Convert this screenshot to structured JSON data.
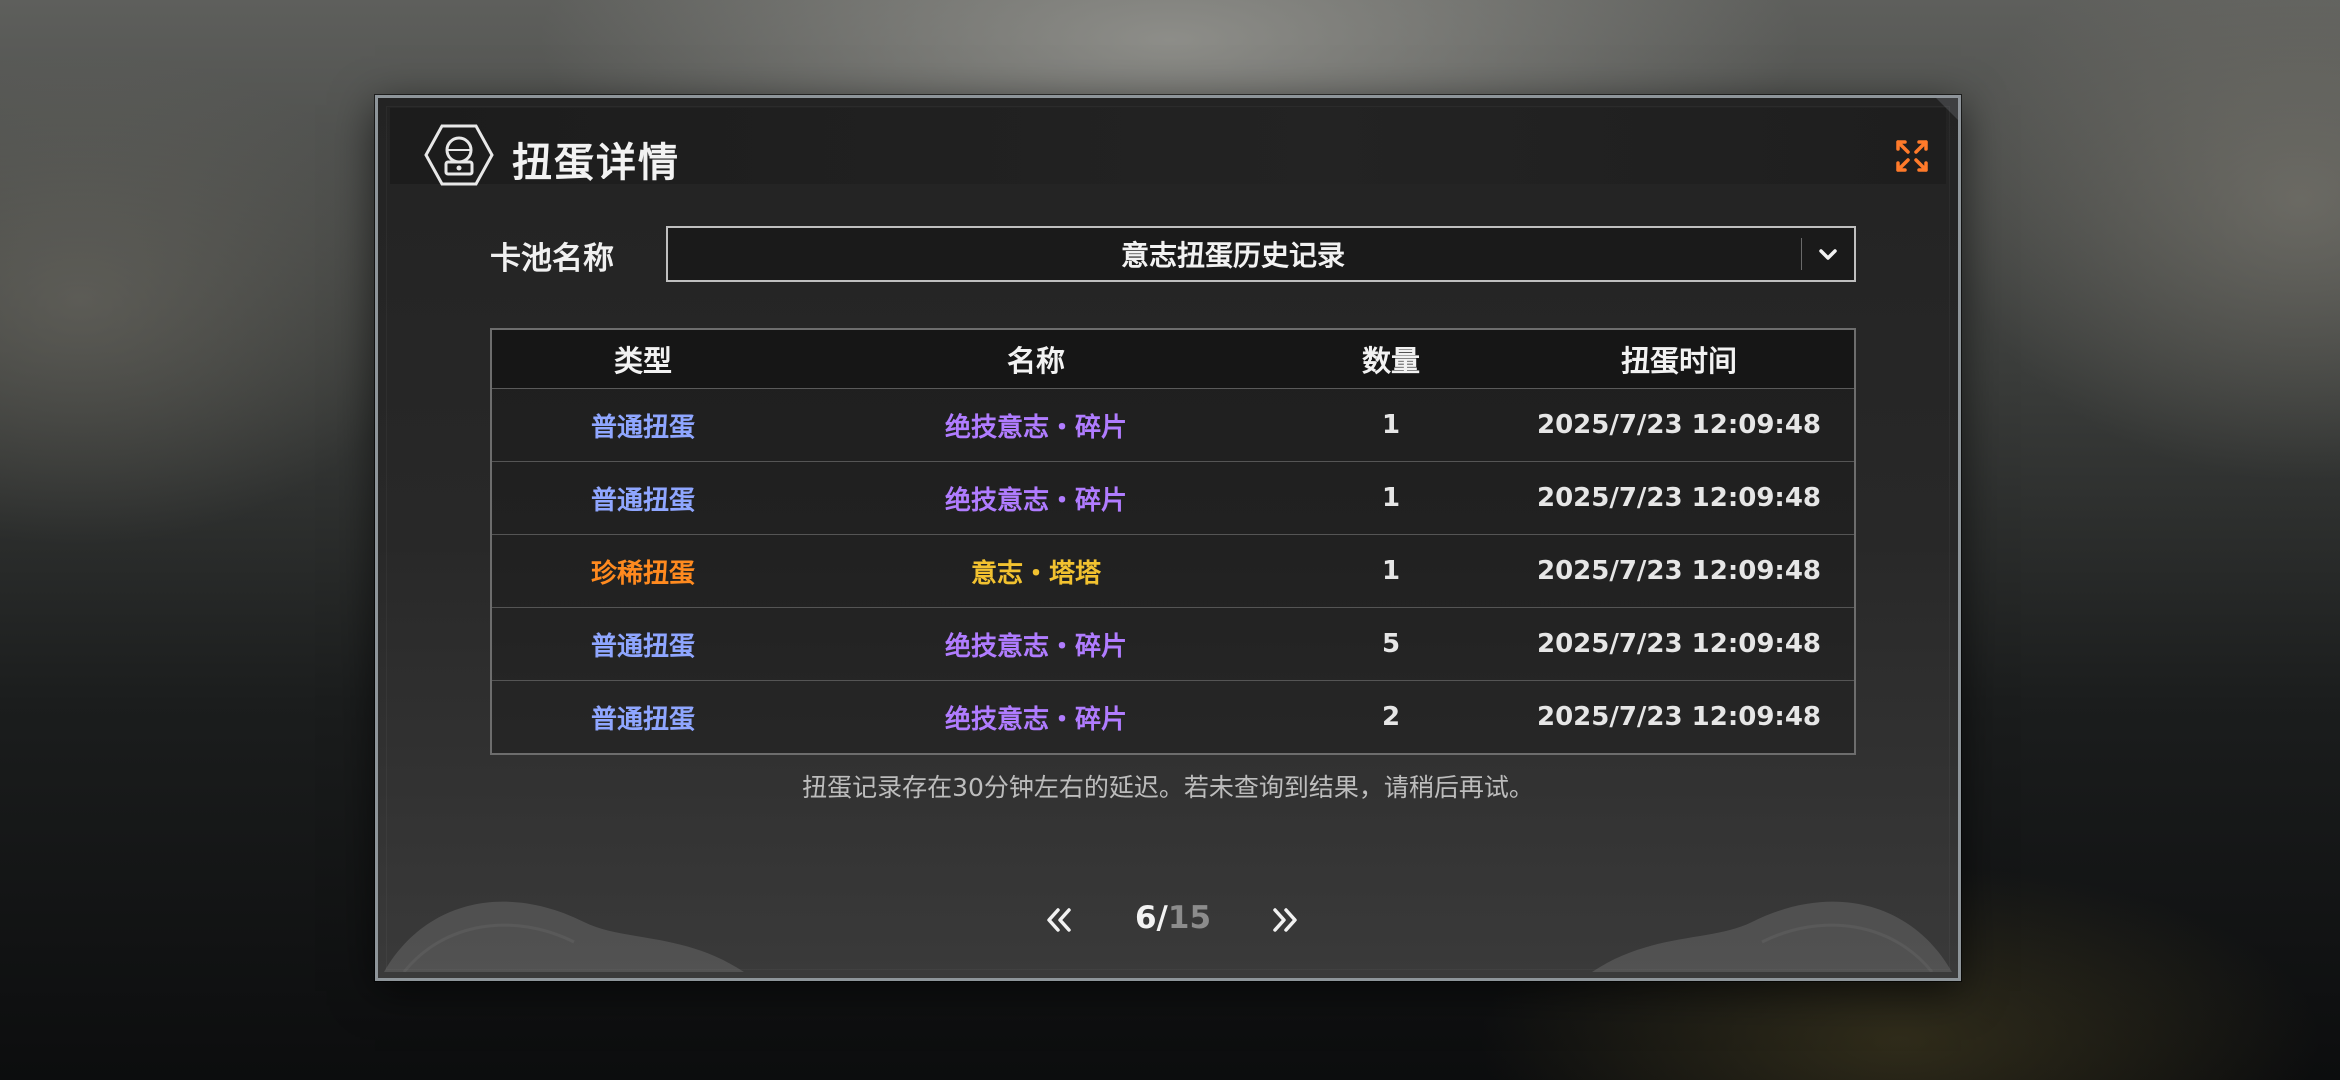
{
  "dialog": {
    "title": "扭蛋详情",
    "title_icon": "gacha-machine-icon",
    "close_icon": "close-icon"
  },
  "pool": {
    "label": "卡池名称",
    "selected": "意志扭蛋历史记录"
  },
  "table": {
    "headers": [
      "类型",
      "名称",
      "数量",
      "扭蛋时间"
    ],
    "rows": [
      {
        "type": "普通扭蛋",
        "name": "绝技意志・碎片",
        "qty": "1",
        "time": "2025/7/23 12:09:48",
        "type_color": "#8fa6ff",
        "name_color": "#b07cff"
      },
      {
        "type": "普通扭蛋",
        "name": "绝技意志・碎片",
        "qty": "1",
        "time": "2025/7/23 12:09:48",
        "type_color": "#8fa6ff",
        "name_color": "#b07cff"
      },
      {
        "type": "珍稀扭蛋",
        "name": "意志・塔塔",
        "qty": "1",
        "time": "2025/7/23 12:09:48",
        "type_color": "#ff8a1f",
        "name_color": "#f2c230"
      },
      {
        "type": "普通扭蛋",
        "name": "绝技意志・碎片",
        "qty": "5",
        "time": "2025/7/23 12:09:48",
        "type_color": "#8fa6ff",
        "name_color": "#b07cff"
      },
      {
        "type": "普通扭蛋",
        "name": "绝技意志・碎片",
        "qty": "2",
        "time": "2025/7/23 12:09:48",
        "type_color": "#8fa6ff",
        "name_color": "#b07cff"
      }
    ]
  },
  "notice": "扭蛋记录存在30分钟左右的延迟。若未查询到结果，请稍后再试。",
  "pager": {
    "current": "6",
    "separator": "/",
    "total": "15"
  },
  "colors": {
    "accent_close": "#ff7a2a",
    "common": "#8fa6ff",
    "rare": "#ff8a1f",
    "item_common": "#b07cff",
    "item_rare": "#f2c230"
  }
}
